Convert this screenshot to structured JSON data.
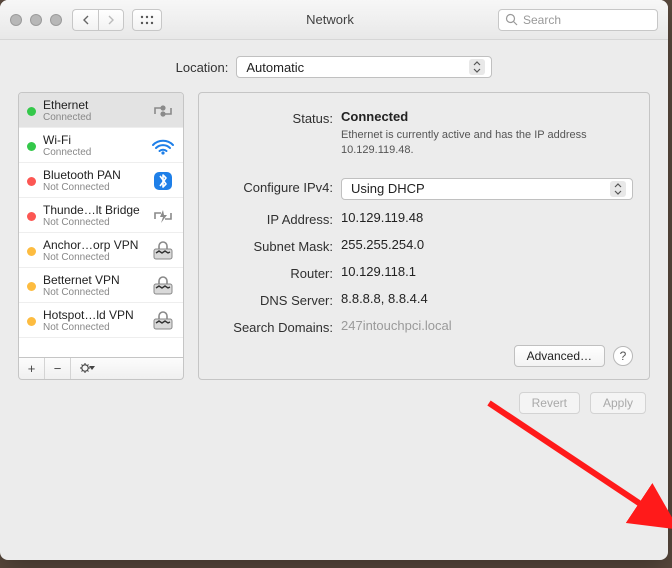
{
  "window": {
    "title": "Network"
  },
  "search": {
    "placeholder": "Search"
  },
  "location": {
    "label": "Location:",
    "value": "Automatic"
  },
  "sidebar": {
    "items": [
      {
        "name": "Ethernet",
        "status": "Connected",
        "dot": "green",
        "icon": "ethernet",
        "selected": true
      },
      {
        "name": "Wi-Fi",
        "status": "Connected",
        "dot": "green",
        "icon": "wifi"
      },
      {
        "name": "Bluetooth PAN",
        "status": "Not Connected",
        "dot": "red",
        "icon": "bluetooth"
      },
      {
        "name": "Thunde…lt Bridge",
        "status": "Not Connected",
        "dot": "red",
        "icon": "thunderbolt"
      },
      {
        "name": "Anchor…orp VPN",
        "status": "Not Connected",
        "dot": "orange",
        "icon": "vpn"
      },
      {
        "name": "Betternet VPN",
        "status": "Not Connected",
        "dot": "orange",
        "icon": "vpn"
      },
      {
        "name": "Hotspot…ld VPN",
        "status": "Not Connected",
        "dot": "orange",
        "icon": "vpn"
      }
    ]
  },
  "details": {
    "status_label": "Status:",
    "status_value": "Connected",
    "status_sub": "Ethernet is currently active and has the IP address 10.129.119.48.",
    "configure_label": "Configure IPv4:",
    "configure_value": "Using DHCP",
    "ip_label": "IP Address:",
    "ip_value": "10.129.119.48",
    "subnet_label": "Subnet Mask:",
    "subnet_value": "255.255.254.0",
    "router_label": "Router:",
    "router_value": "10.129.118.1",
    "dns_label": "DNS Server:",
    "dns_value": "8.8.8.8, 8.8.4.4",
    "search_label": "Search Domains:",
    "search_value": "247intouchpci.local"
  },
  "buttons": {
    "advanced": "Advanced…",
    "revert": "Revert",
    "apply": "Apply"
  }
}
